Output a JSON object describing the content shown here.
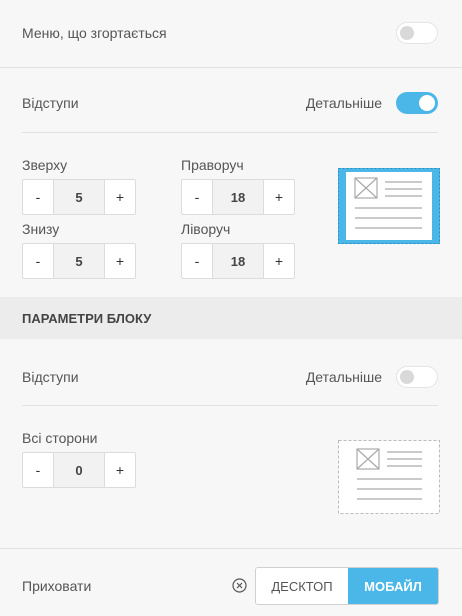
{
  "collapsible": {
    "label": "Меню, що згортається",
    "toggle_on": false
  },
  "spacing": {
    "label": "Відступи",
    "detail_label": "Детальніше",
    "detail_on": true,
    "top": {
      "label": "Зверху",
      "value": "5"
    },
    "right": {
      "label": "Праворуч",
      "value": "18"
    },
    "bottom": {
      "label": "Знизу",
      "value": "5"
    },
    "left": {
      "label": "Ліворуч",
      "value": "18"
    }
  },
  "block_params": {
    "title": "ПАРАМЕТРИ БЛОКУ"
  },
  "block_spacing": {
    "label": "Відступи",
    "detail_label": "Детальніше",
    "detail_on": false,
    "all": {
      "label": "Всі сторони",
      "value": "0"
    }
  },
  "stepper": {
    "minus": "-",
    "plus": "+"
  },
  "footer": {
    "hide_label": "Приховати",
    "desktop": "ДЕСКТОП",
    "mobile": "МОБАЙЛ"
  },
  "colors": {
    "accent": "#4bb7e8",
    "background": "#f7f7f7",
    "section": "#ececec"
  }
}
